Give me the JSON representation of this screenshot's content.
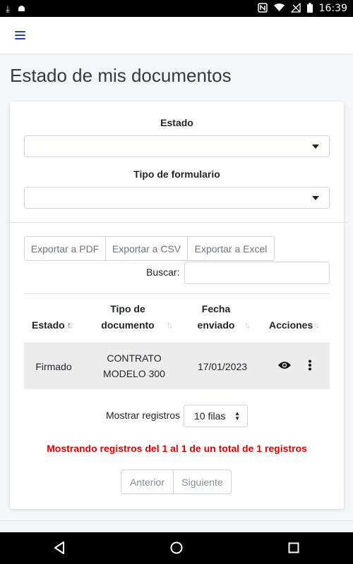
{
  "status_bar": {
    "time": "16:39"
  },
  "header": {
    "menu_icon": "hamburger-menu-icon",
    "accent": "#2342a8"
  },
  "page": {
    "title": "Estado de mis documentos"
  },
  "filters": {
    "estado_label": "Estado",
    "estado_value": "",
    "tipo_label": "Tipo de formulario",
    "tipo_value": ""
  },
  "export": {
    "pdf": "Exportar a PDF",
    "csv": "Exportar a CSV",
    "excel": "Exportar a Excel"
  },
  "search": {
    "label": "Buscar:",
    "value": ""
  },
  "table": {
    "columns": [
      {
        "line1": "Estado",
        "line2": ""
      },
      {
        "line1": "Tipo de",
        "line2": "documento"
      },
      {
        "line1": "Fecha",
        "line2": "enviado"
      },
      {
        "line1": "Acciones",
        "line2": ""
      }
    ],
    "rows": [
      {
        "estado": "Firmado",
        "tipo_line1": "CONTRATO",
        "tipo_line2": "MODELO 300",
        "fecha": "17/01/2023"
      }
    ]
  },
  "length": {
    "label": "Mostrar registros",
    "selected": "10 filas"
  },
  "info": {
    "text": "Mostrando registros del 1 al 1 de un total de 1 registros",
    "color": "#e60000"
  },
  "pagination": {
    "prev": "Anterior",
    "next": "Siguiente"
  }
}
